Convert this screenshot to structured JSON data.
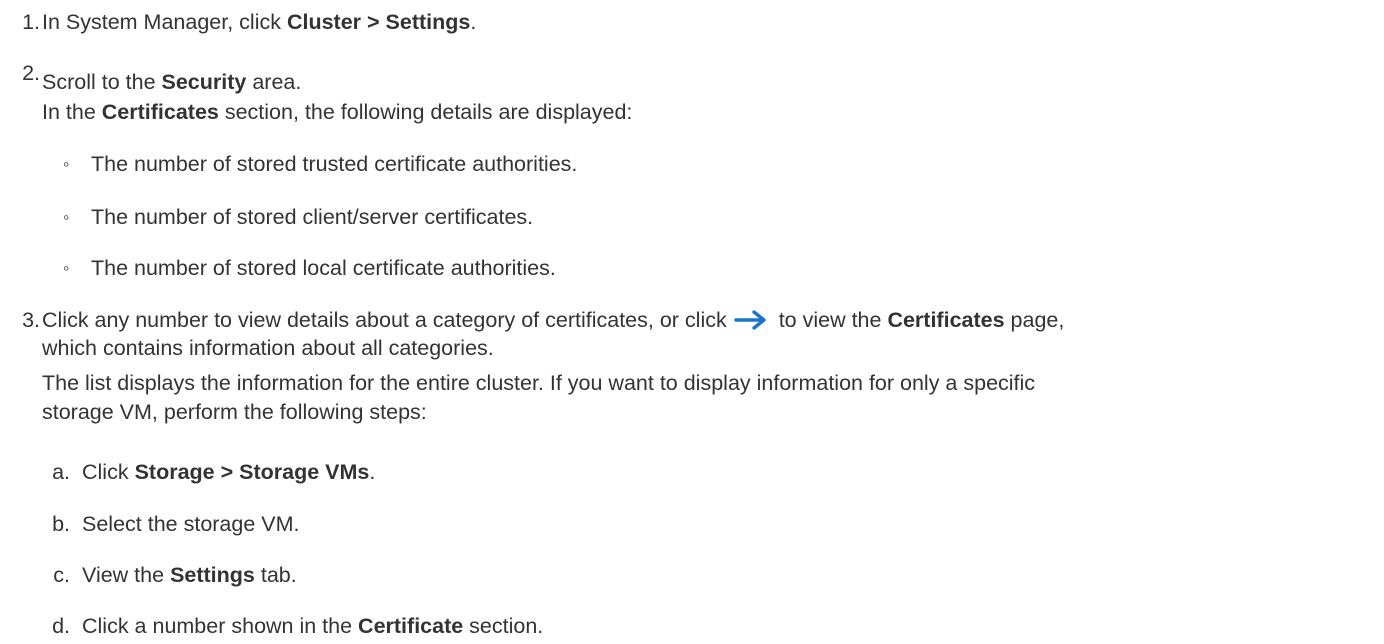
{
  "steps": [
    {
      "number": "1.",
      "text_before": "In System Manager, click ",
      "bold": "Cluster > Settings",
      "text_after": "."
    },
    {
      "number": "2.",
      "line1_before": "Scroll to the ",
      "line1_bold": "Security",
      "line1_after": " area.",
      "line2_before": "In the ",
      "line2_bold": "Certificates",
      "line2_after": " section, the following details are displayed:",
      "bullets": [
        "The number of stored trusted certificate authorities.",
        "The number of stored client/server certificates.",
        "The number of stored local certificate authorities."
      ],
      "bullet_glyph": "◦"
    },
    {
      "number": "3.",
      "line1_before": "Click any number to view details about a category of certificates, or click",
      "line1_mid": " to view the ",
      "line1_bold": "Certificates",
      "line1_after": " page,",
      "line2": "which contains information about all categories.",
      "line3": "The list displays the information for the entire cluster. If you want to display information for only a specific",
      "line4": "storage VM, perform the following steps:",
      "arrow_color": "#1a73c8",
      "substeps": [
        {
          "letter": "a.",
          "before": "Click ",
          "bold": "Storage > Storage VMs",
          "after": "."
        },
        {
          "letter": "b.",
          "before": "Select the storage VM.",
          "bold": "",
          "after": ""
        },
        {
          "letter": "c.",
          "before": "View the ",
          "bold": "Settings",
          "after": " tab."
        },
        {
          "letter": "d.",
          "before": "Click a number shown in the ",
          "bold": "Certificate",
          "after": " section."
        }
      ]
    }
  ]
}
